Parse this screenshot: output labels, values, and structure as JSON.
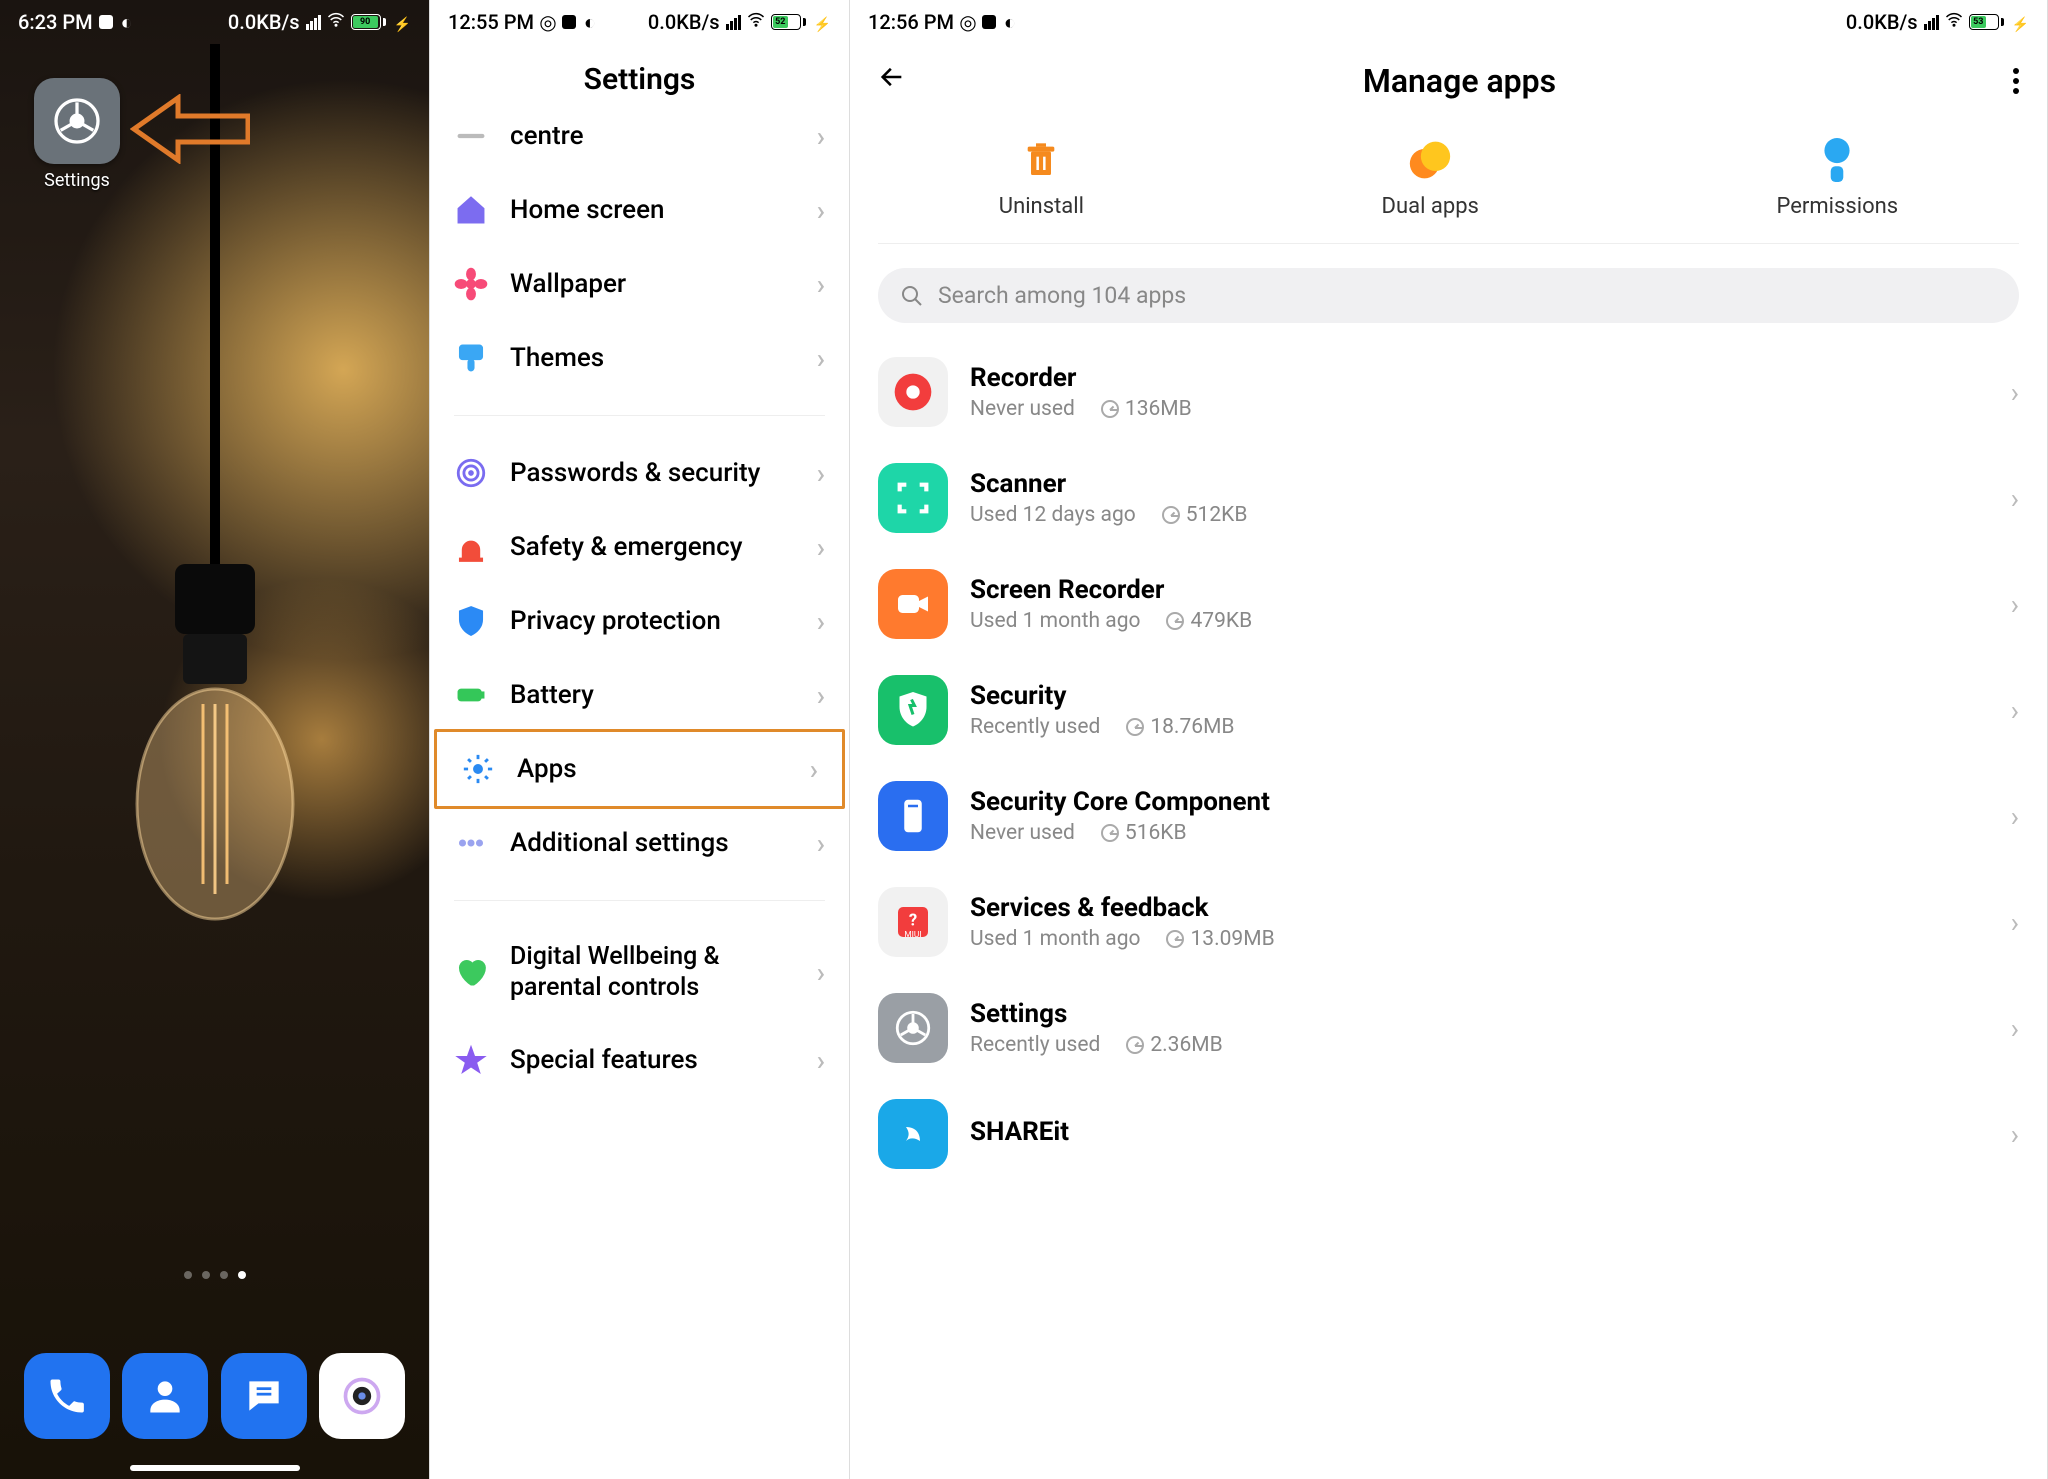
{
  "pane1": {
    "status": {
      "time": "6:23 PM",
      "net": "0.0KB/s",
      "battery_text": "90"
    },
    "settings_app_label": "Settings",
    "dock": [
      "Phone",
      "Contacts",
      "Messages",
      "Camera"
    ]
  },
  "pane2": {
    "status": {
      "time": "12:55 PM",
      "net": "0.0KB/s",
      "battery_text": "52"
    },
    "title": "Settings",
    "items": [
      {
        "label": "centre",
        "icon": "notification",
        "partial_top": true,
        "color": "#bbb"
      },
      {
        "label": "Home screen",
        "icon": "home",
        "color": "#7c6cf0"
      },
      {
        "label": "Wallpaper",
        "icon": "flower",
        "color": "#f74b78"
      },
      {
        "label": "Themes",
        "icon": "brush",
        "color": "#3aa7f4"
      }
    ],
    "items2": [
      {
        "label": "Passwords & security",
        "icon": "fingerprint",
        "color": "#7a6cf0"
      },
      {
        "label": "Safety & emergency",
        "icon": "siren",
        "color": "#f24d3a"
      },
      {
        "label": "Privacy protection",
        "icon": "shield",
        "color": "#2b8af5"
      },
      {
        "label": "Battery",
        "icon": "battery",
        "color": "#34c759"
      },
      {
        "label": "Apps",
        "icon": "gear",
        "color": "#2a8af2",
        "highlight": true
      },
      {
        "label": "Additional settings",
        "icon": "dots",
        "color": "#9aa3ef"
      }
    ],
    "items3": [
      {
        "label": "Digital Wellbeing & parental controls",
        "icon": "heart",
        "color": "#3cc95e",
        "multiline": true
      },
      {
        "label": "Special features",
        "icon": "star",
        "color": "#8a5cf0",
        "partial_bottom": true
      }
    ]
  },
  "pane3": {
    "status": {
      "time": "12:56 PM",
      "net": "0.0KB/s",
      "battery_text": "53"
    },
    "title": "Manage apps",
    "quick": [
      {
        "label": "Uninstall",
        "icon": "trash",
        "color": "#f58a1e"
      },
      {
        "label": "Dual apps",
        "icon": "dual",
        "color": "#ffc61e"
      },
      {
        "label": "Permissions",
        "icon": "perm",
        "color": "#2aa8f2"
      }
    ],
    "search_placeholder": "Search among 104 apps",
    "apps": [
      {
        "name": "Recorder",
        "usage": "Never used",
        "size": "136MB",
        "bg": "bg-recorder"
      },
      {
        "name": "Scanner",
        "usage": "Used 12 days ago",
        "size": "512KB",
        "bg": "bg-scanner"
      },
      {
        "name": "Screen Recorder",
        "usage": "Used 1 month ago",
        "size": "479KB",
        "bg": "bg-screc"
      },
      {
        "name": "Security",
        "usage": "Recently used",
        "size": "18.76MB",
        "bg": "bg-sec"
      },
      {
        "name": "Security Core Component",
        "usage": "Never used",
        "size": "516KB",
        "bg": "bg-seccore"
      },
      {
        "name": "Services & feedback",
        "usage": "Used 1 month ago",
        "size": "13.09MB",
        "bg": "bg-serv"
      },
      {
        "name": "Settings",
        "usage": "Recently used",
        "size": "2.36MB",
        "bg": "bg-settings"
      },
      {
        "name": "SHAREit",
        "usage": "",
        "size": "",
        "bg": "bg-shareit",
        "partial_bottom": true
      }
    ]
  }
}
